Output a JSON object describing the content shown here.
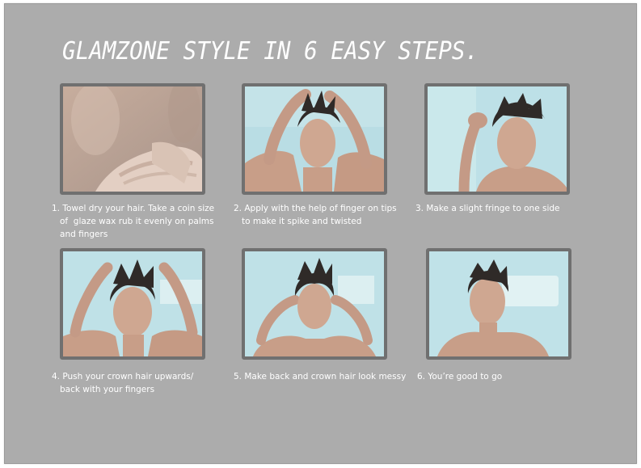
{
  "title": "GLAMZONE STYLE IN 6 EASY STEPS.",
  "steps": [
    {
      "caption": "1. Towel dry your hair. Take a coin size\n   of  glaze wax rub it evenly on palms\n   and fingers"
    },
    {
      "caption": "2. Apply with the help of finger on tips\n   to make it spike and twisted"
    },
    {
      "caption": "3. Make a slight fringe to one side"
    },
    {
      "caption": "4. Push your crown hair upwards/\n   back with your fingers"
    },
    {
      "caption": "5. Make back and crown hair look messy"
    },
    {
      "caption": "6. You’re good to go"
    }
  ],
  "colors": {
    "panel": "#acacac",
    "photo_border": "#707070",
    "photo_background": "#b8dce2",
    "skin": "#c9a08a",
    "hair": "#2f2a28"
  }
}
